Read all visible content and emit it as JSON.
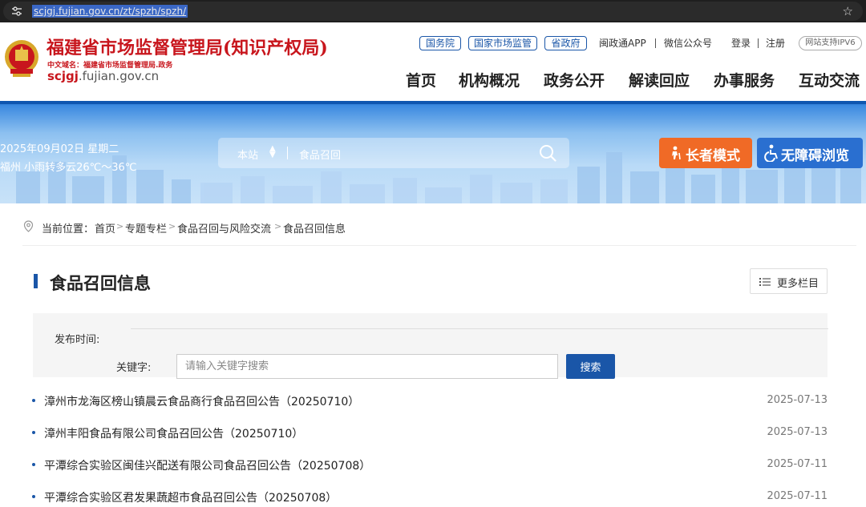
{
  "browser": {
    "url": "scjgj.fujian.gov.cn/zt/spzh/spzh/"
  },
  "header": {
    "site_name": "福建省市场监督管理局(知识产权局)",
    "cn_domain": "中文域名：福建省市场监督管理局.政务",
    "domain_main": "scjgj",
    "domain_rest": ".fujian.gov.cn",
    "top_links": {
      "guowuyuan": "国务院",
      "guojia": "国家市场监管",
      "shengzhengfu": "省政府",
      "app": "闽政通APP",
      "wechat": "微信公众号",
      "login": "登录",
      "register": "注册",
      "ipv6": "网站支持IPV6"
    },
    "nav": [
      "首页",
      "机构概况",
      "政务公开",
      "解读回应",
      "办事服务",
      "互动交流"
    ]
  },
  "banner": {
    "date": "2025年09月02日 星期二",
    "weather": "福州 小雨转多云26℃～36℃",
    "search_scope": "本站",
    "search_value": "食品召回",
    "elder_mode": "长者模式",
    "accessible": "无障碍浏览"
  },
  "breadcrumb": {
    "label": "当前位置：",
    "items": [
      "首页",
      "专题专栏",
      "食品召回与风险交流",
      "食品召回信息"
    ]
  },
  "section": {
    "title": "食品召回信息",
    "more": "更多栏目"
  },
  "filter": {
    "publish_time_label": "发布时间:",
    "keyword_label": "关键字:",
    "keyword_placeholder": "请输入关键字搜索",
    "search_button": "搜索"
  },
  "news": [
    {
      "title": "漳州市龙海区榜山镇晨云食品商行食品召回公告（20250710）",
      "date": "2025-07-13"
    },
    {
      "title": "漳州丰阳食品有限公司食品召回公告（20250710）",
      "date": "2025-07-13"
    },
    {
      "title": "平潭综合实验区闽佳兴配送有限公司食品召回公告（20250708）",
      "date": "2025-07-11"
    },
    {
      "title": "平潭综合实验区君发果蔬超市食品召回公告（20250708）",
      "date": "2025-07-11"
    }
  ],
  "colors": {
    "brand_red": "#c8161d",
    "brand_blue": "#1a56a8",
    "elder_orange": "#f06a26"
  }
}
